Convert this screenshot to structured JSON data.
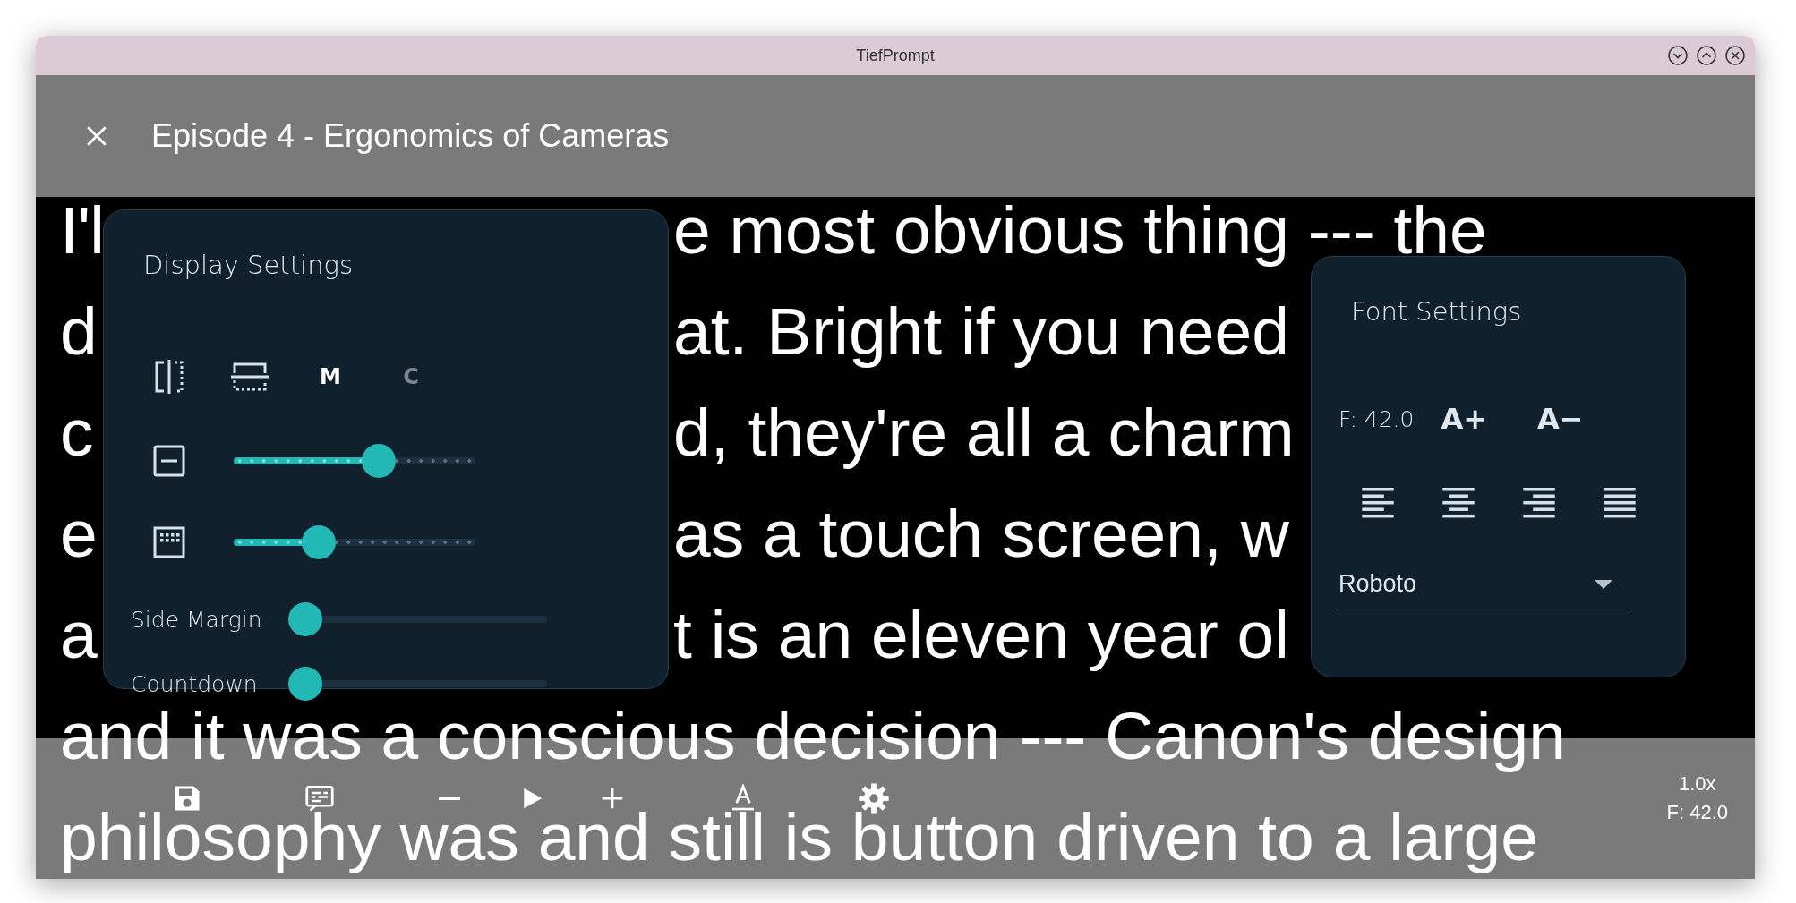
{
  "window": {
    "title": "TiefPrompt"
  },
  "header": {
    "title": "Episode 4 - Ergonomics of Cameras"
  },
  "script_lines": [
    {
      "kind": "split",
      "left": "I'l",
      "right": "e most obvious thing --- the"
    },
    {
      "kind": "split",
      "left": "d",
      "right": "at. Bright if you need"
    },
    {
      "kind": "split",
      "left": "c",
      "right": "d, they're all a charm"
    },
    {
      "kind": "split",
      "left": "e",
      "right": "as a touch screen, w"
    },
    {
      "kind": "split",
      "left": "a",
      "right": "t is an eleven year ol"
    },
    {
      "kind": "full",
      "text": "and it was a conscious decision --- Canon's design"
    },
    {
      "kind": "full",
      "text": "philosophy was and still is button driven to a large"
    }
  ],
  "display_settings": {
    "title": "Display Settings",
    "mirror_buttons": [
      {
        "kind": "vertical"
      },
      {
        "kind": "horizontal"
      }
    ],
    "letter_toggles": [
      {
        "label": "M",
        "on": true
      },
      {
        "label": "C",
        "on": false
      }
    ],
    "sliders": [
      {
        "kind": "spacing",
        "level": 0.6
      },
      {
        "kind": "grid",
        "level": 0.35
      }
    ],
    "labeled_sliders": [
      {
        "label": "Side Margin",
        "level": 0
      },
      {
        "label": "Countdown",
        "level": 0
      }
    ]
  },
  "font_settings": {
    "title": "Font Settings",
    "size": "F: 42.0",
    "buttons": [
      "A+",
      "A−"
    ],
    "alignments": [
      {
        "kind": "left"
      },
      {
        "kind": "center"
      },
      {
        "kind": "right"
      },
      {
        "kind": "justify"
      }
    ],
    "font": "Roboto"
  },
  "toolbar": {
    "buttons": [
      {
        "kind": "save"
      },
      {
        "kind": "subtitles"
      },
      {
        "kind": "minus"
      },
      {
        "kind": "play"
      },
      {
        "kind": "plus"
      },
      {
        "kind": "text-format"
      },
      {
        "kind": "settings"
      }
    ],
    "speed": "1.0x",
    "font_size": "F: 42.0"
  }
}
